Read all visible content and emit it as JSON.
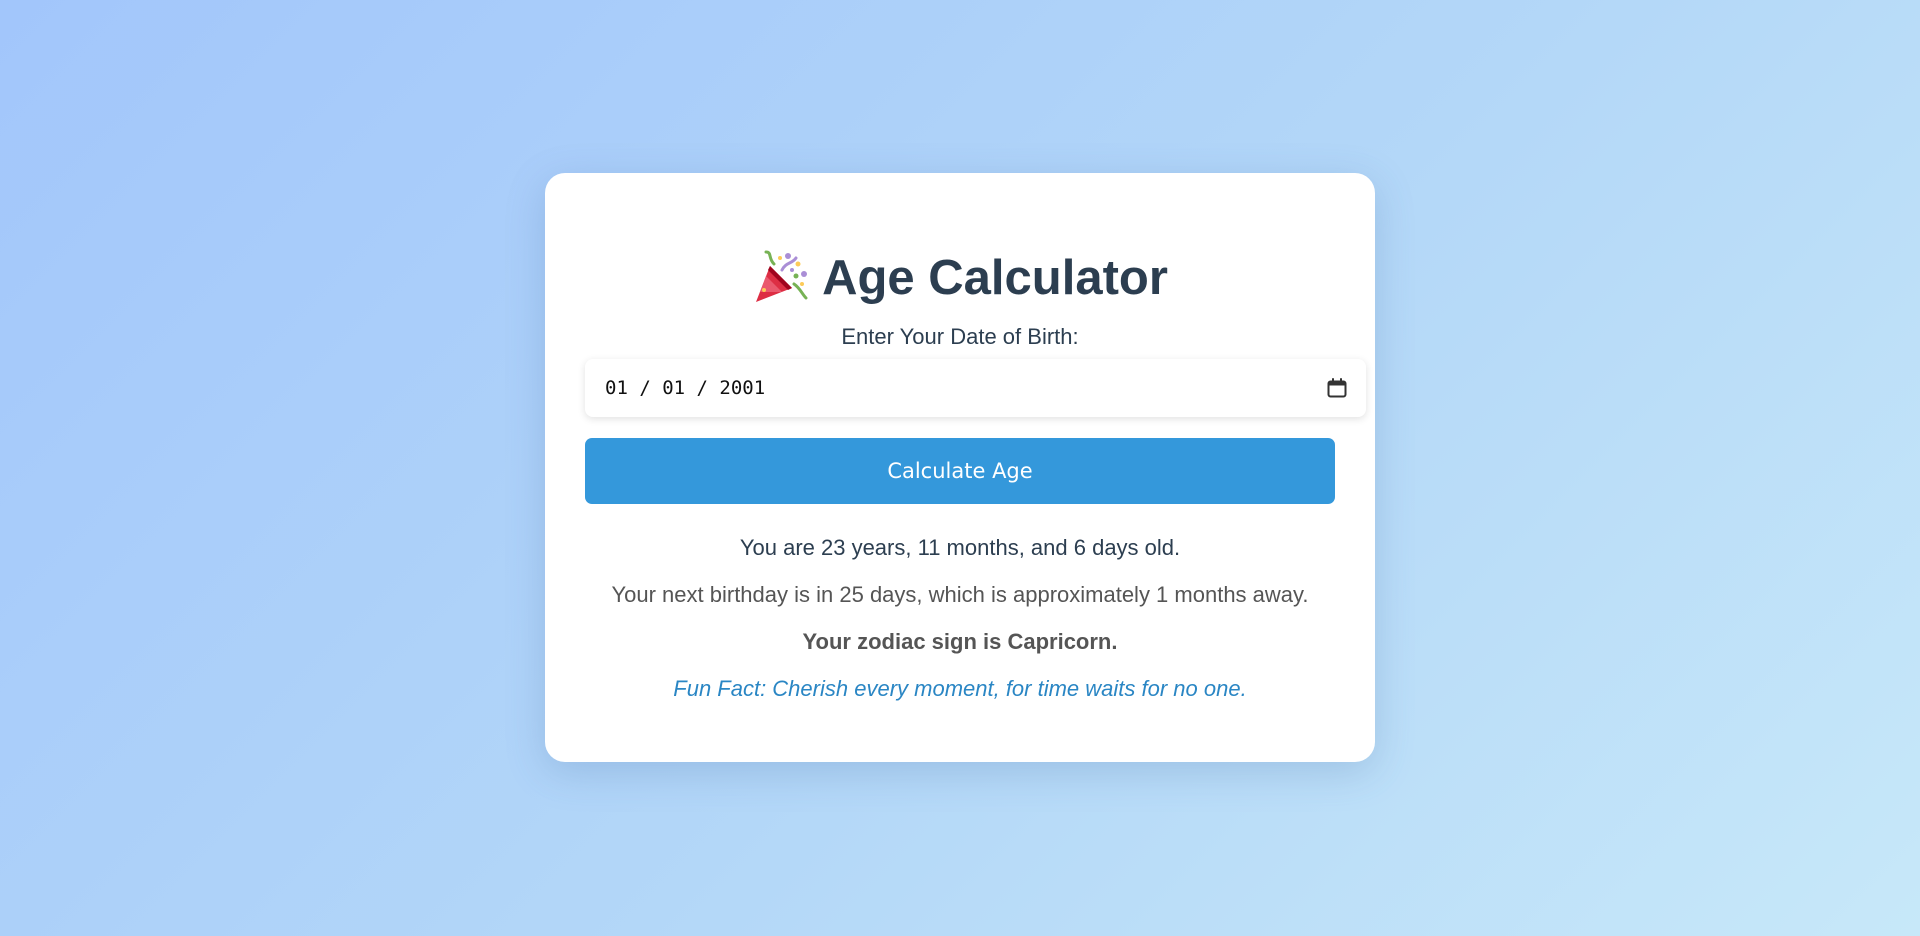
{
  "header": {
    "icon": "party-popper-icon",
    "title": "Age Calculator"
  },
  "form": {
    "dob_label": "Enter Your Date of Birth:",
    "dob_value": "01 / 01 / 2001",
    "calendar_icon": "calendar-icon",
    "calculate_label": "Calculate Age"
  },
  "results": {
    "age": "You are 23 years, 11 months, and 6 days old.",
    "next_birthday": "Your next birthday is in 25 days, which is approximately 1 months away.",
    "zodiac": "Your zodiac sign is Capricorn.",
    "fun_fact": "Fun Fact: Cherish every moment, for time waits for no one."
  },
  "colors": {
    "accent": "#3498db",
    "title": "#2c3e50",
    "fun_fact": "#2a86c4"
  }
}
